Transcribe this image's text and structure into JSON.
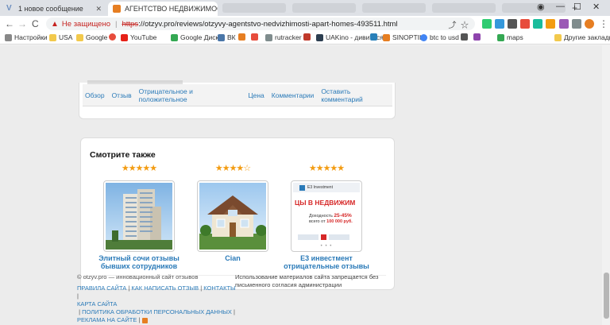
{
  "browser": {
    "tabs": [
      {
        "title": "1 новое сообщение",
        "favicon_color": "#6c8ebf",
        "active": false
      },
      {
        "title": "АГЕНТСТВО НЕДВИЖИМОСТИ А",
        "favicon_color": "#e67e22",
        "active": true
      }
    ],
    "window_controls": {
      "minimize": "—",
      "maximize": "☐",
      "close": "✕"
    },
    "nav": {
      "back": "←",
      "forward": "→",
      "reload": "C"
    },
    "address": {
      "security_label": "Не защищено",
      "scheme": "https",
      "url_rest": "://otzyv.pro/reviews/otzyvy-agentstvo-nedvizhimosti-apart-homes-493511.html"
    },
    "bookmarks": [
      {
        "label": "Настройки",
        "icon": "apps-icon",
        "color": "#888"
      },
      {
        "label": "USA",
        "icon": "folder-icon",
        "color": "#f2c94c"
      },
      {
        "label": "Google",
        "icon": "folder-icon",
        "color": "#f2c94c"
      },
      {
        "label": "",
        "icon": "b-icon",
        "color": "#e74c3c"
      },
      {
        "label": "YouTube",
        "icon": "youtube-icon",
        "color": "#e62117"
      },
      {
        "label": "Google Диск",
        "icon": "drive-icon",
        "color": "#34a853"
      },
      {
        "label": "ВК",
        "icon": "vk-icon",
        "color": "#4a76a8"
      },
      {
        "label": "",
        "icon": "f-icon",
        "color": "#e67e22"
      },
      {
        "label": "",
        "icon": "orange-icon",
        "color": "#e74c3c"
      },
      {
        "label": "rutracker",
        "icon": "rutracker-icon",
        "color": "#7f8c8d"
      },
      {
        "label": "",
        "icon": "pdf-icon",
        "color": "#c0392b"
      },
      {
        "label": "UAKino - дивитися...",
        "icon": "uakino-icon",
        "color": "#2c3e50"
      },
      {
        "label": "",
        "icon": "flag-icon",
        "color": "#2980b9"
      },
      {
        "label": "SINOPTIK",
        "icon": "sinoptik-icon",
        "color": "#e67e22"
      },
      {
        "label": "btc to usd",
        "icon": "google-g-icon",
        "color": "#4285f4"
      },
      {
        "label": "",
        "icon": "extension-icon",
        "color": "#555"
      },
      {
        "label": "",
        "icon": "bg-icon",
        "color": "#8e44ad"
      },
      {
        "label": "maps",
        "icon": "maps-icon",
        "color": "#34a853"
      }
    ],
    "other_bookmarks": "Другие закладки"
  },
  "review_tabs": [
    "Обзор",
    "Отзыв",
    "Отрицательное и положительное",
    "Цена",
    "Комментарии",
    "Оставить комментарий"
  ],
  "similar": {
    "title": "Смотрите также",
    "items": [
      {
        "stars": "★★★★★",
        "rating": 5,
        "caption": "Элитный сочи отзывы бывших сотрудников",
        "image": "building"
      },
      {
        "stars": "★★★★☆",
        "rating": 4,
        "caption": "Cian",
        "image": "house"
      },
      {
        "stars": "★★★★★",
        "rating": 5,
        "caption": "Е3 инвестмент отрицательные отзывы",
        "image": "ad",
        "ad": {
          "brand": "E3 Investment",
          "headline": "ЦЫ В НЕДВИЖИМ",
          "line1": "Доходность",
          "pct": "25-45%",
          "line2": "всего от",
          "amount": "100 000 руб."
        }
      }
    ]
  },
  "footer": {
    "copyright": "© otzyv.pro — инновационный сайт отзывов",
    "links": [
      "ПРАВИЛА САЙТА",
      "КАК НАПИСАТЬ ОТЗЫВ",
      "КОНТАКТЫ",
      "КАРТА САЙТА",
      "ПОЛИТИКА ОБРАБОТКИ ПЕРСОНАЛЬНЫХ ДАННЫХ",
      "РЕКЛАМА НА САЙТЕ"
    ],
    "notice": "Использование материалов сайта запрещается без письменного согласия администрации"
  }
}
